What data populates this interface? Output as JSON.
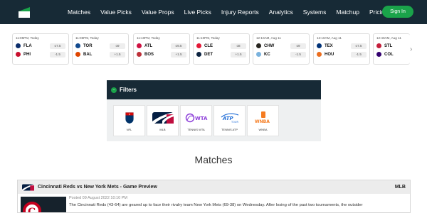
{
  "nav": {
    "items": [
      "Matches",
      "Value Picks",
      "Value Props",
      "Live Picks",
      "Injury Reports",
      "Analytics",
      "Systems",
      "Matchup",
      "Pricing"
    ],
    "signin": "Sign In"
  },
  "games": [
    {
      "time": "11:05PM, Today",
      "away": {
        "abbr": "FLA",
        "odds": "o7.5",
        "color": "#0b2d6b"
      },
      "home": {
        "abbr": "PHI",
        "odds": "-1.5",
        "color": "#c8102e"
      }
    },
    {
      "time": "11:05PM, Today",
      "away": {
        "abbr": "TOR",
        "odds": "o9",
        "color": "#134a8e"
      },
      "home": {
        "abbr": "BAL",
        "odds": "+1.5",
        "color": "#df4601"
      }
    },
    {
      "time": "11:10PM, Today",
      "away": {
        "abbr": "ATL",
        "odds": "o9.5",
        "color": "#ce1141"
      },
      "home": {
        "abbr": "BOS",
        "odds": "+1.5",
        "color": "#bd3039"
      }
    },
    {
      "time": "11:10PM, Today",
      "away": {
        "abbr": "CLE",
        "odds": "o8",
        "color": "#e31937"
      },
      "home": {
        "abbr": "DET",
        "odds": "+1.5",
        "color": "#0c2340"
      }
    },
    {
      "time": "12:10AM, Aug 11",
      "away": {
        "abbr": "CHW",
        "odds": "o9",
        "color": "#27251f"
      },
      "home": {
        "abbr": "KC",
        "odds": "-1.5",
        "color": "#7ab2dd"
      }
    },
    {
      "time": "12:10AM, Aug 11",
      "away": {
        "abbr": "TEX",
        "odds": "o7.5",
        "color": "#003278"
      },
      "home": {
        "abbr": "HOU",
        "odds": "-1.5",
        "color": "#eb6e1f"
      }
    },
    {
      "time": "12:40AM, Aug 11",
      "away": {
        "abbr": "STL",
        "odds": "",
        "color": "#c41e3a"
      },
      "home": {
        "abbr": "COL",
        "odds": "",
        "color": "#33006f"
      }
    }
  ],
  "filters": {
    "title": "Filters",
    "leagues": [
      {
        "name": "NFL",
        "icon": "nfl-logo"
      },
      {
        "name": "MLB",
        "icon": "mlb-logo"
      },
      {
        "name": "TENNIS WTA",
        "icon": "wta-logo",
        "logo_text": "WTA"
      },
      {
        "name": "TENNIS ATP",
        "icon": "atp-logo",
        "logo_text": "ATP",
        "logo_sub": "TOUR"
      },
      {
        "name": "WNBA",
        "icon": "wnba-logo",
        "logo_text": "WNBA"
      }
    ]
  },
  "matches_heading": "Matches",
  "preview": {
    "title": "Cincinnati Reds vs New York Mets - Game Preview",
    "league": "MLB",
    "date": "Posted 09 August 2022 10:10 PM",
    "text": "The Cincinnati Reds (43-64) are geared up to face their rivalry team New York Mets (69-38) on Wednesday. After losing of the past two tournaments, the outsider"
  },
  "colors": {
    "nav_bg": "#172a36",
    "accent_green": "#1aa34a",
    "wta_purple": "#8a3ad8",
    "atp_blue": "#1e6bd6",
    "wnba_orange": "#f57b20"
  }
}
